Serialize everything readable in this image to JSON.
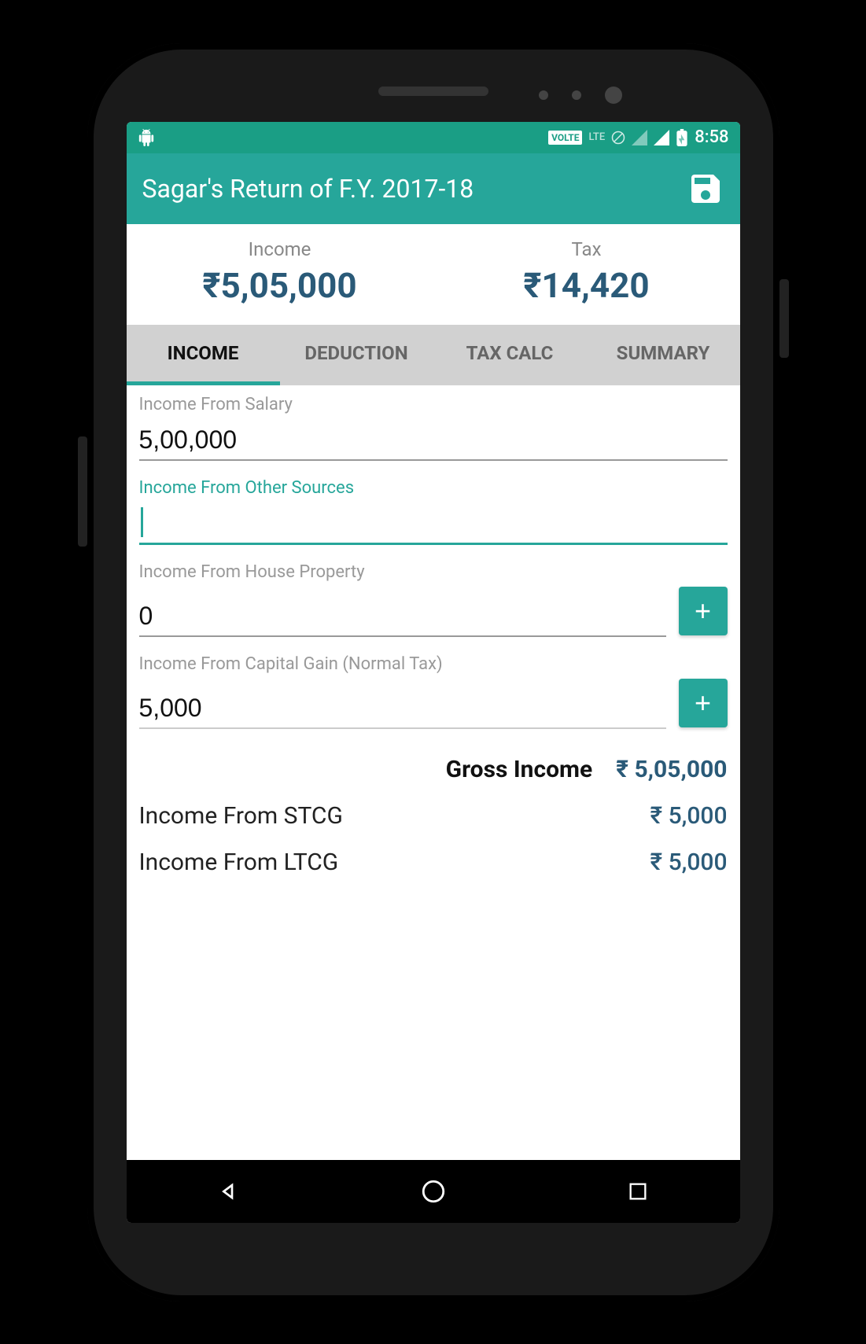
{
  "status": {
    "volte": "VOLTE",
    "lte": "LTE",
    "time": "8:58"
  },
  "header": {
    "title": "Sagar's Return of F.Y. 2017-18"
  },
  "summary": {
    "income_label": "Income",
    "income_value": "₹5,05,000",
    "tax_label": "Tax",
    "tax_value": "₹14,420"
  },
  "tabs": {
    "income": "INCOME",
    "deduction": "DEDUCTION",
    "taxcalc": "TAX CALC",
    "summary": "SUMMARY"
  },
  "fields": {
    "salary": {
      "label": "Income From Salary",
      "value": "5,00,000"
    },
    "other": {
      "label": "Income From Other Sources",
      "value": ""
    },
    "house": {
      "label": "Income From House Property",
      "value": "0"
    },
    "capital": {
      "label": "Income From Capital Gain (Normal Tax)",
      "value": "5,000"
    }
  },
  "add_symbol": "+",
  "results": {
    "gross": {
      "label": "Gross Income",
      "value": "₹ 5,05,000"
    },
    "stcg": {
      "label": "Income From STCG",
      "value": "₹ 5,000"
    },
    "ltcg": {
      "label": "Income From LTCG",
      "value": "₹ 5,000"
    }
  }
}
